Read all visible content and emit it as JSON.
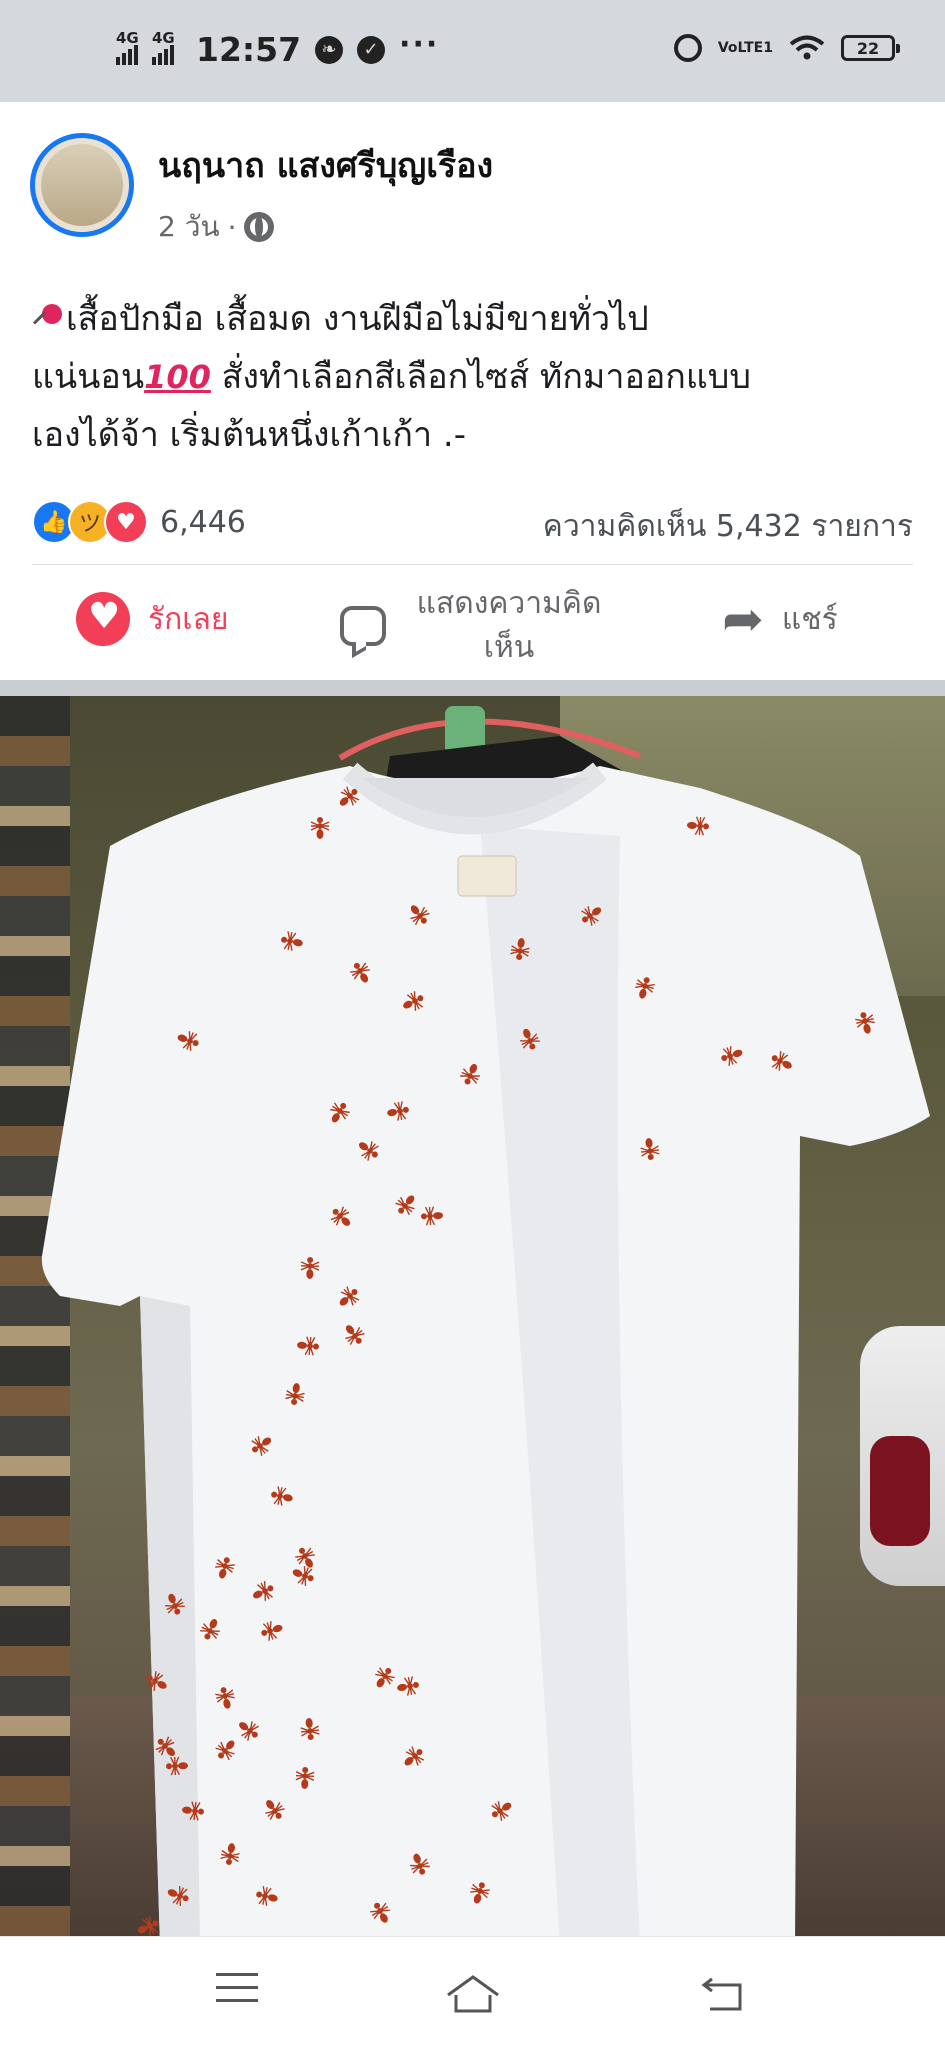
{
  "status_bar": {
    "sim1": "4G",
    "sim2": "4G",
    "time": "12:57",
    "battery": "22",
    "volte": "VoLTE1",
    "more": "···"
  },
  "post": {
    "author": "นฤนาถ แสงศรีบุญเรือง",
    "time_ago": "2 วัน",
    "meta_sep": "·",
    "text_line1": "เสื้อปักมือ เสื้อมด งานฝีมือไม่มีขายทั่วไป",
    "text_line2a": "แน่นอน",
    "text_hundred": "100",
    "text_line2b": " สั่งทำเลือกสีเลือกไซส์ ทักมาออกแบบ",
    "text_line3": "เองได้จ้า เริ่มต้นหนึ่งเก้าเก้า .-",
    "reaction_count": "6,446",
    "comments": "ความคิดเห็น 5,432 รายการ"
  },
  "actions": {
    "love_label": "รักเลย",
    "comment_label": "แสดงความคิดเห็น",
    "share_label": "แชร์"
  },
  "photo": {
    "subject": "embroidered-ant-tshirt"
  },
  "colors": {
    "facebook_blue": "#1877f2",
    "love_red": "#f33e58",
    "haha_yellow": "#f7b125",
    "ant_red": "#b43a1a"
  },
  "icons": [
    "pin-icon",
    "hundred-icon",
    "globe-icon",
    "like-icon",
    "haha-icon",
    "love-icon",
    "heart-icon",
    "comment-icon",
    "share-icon",
    "menu-icon",
    "home-icon",
    "back-icon"
  ]
}
